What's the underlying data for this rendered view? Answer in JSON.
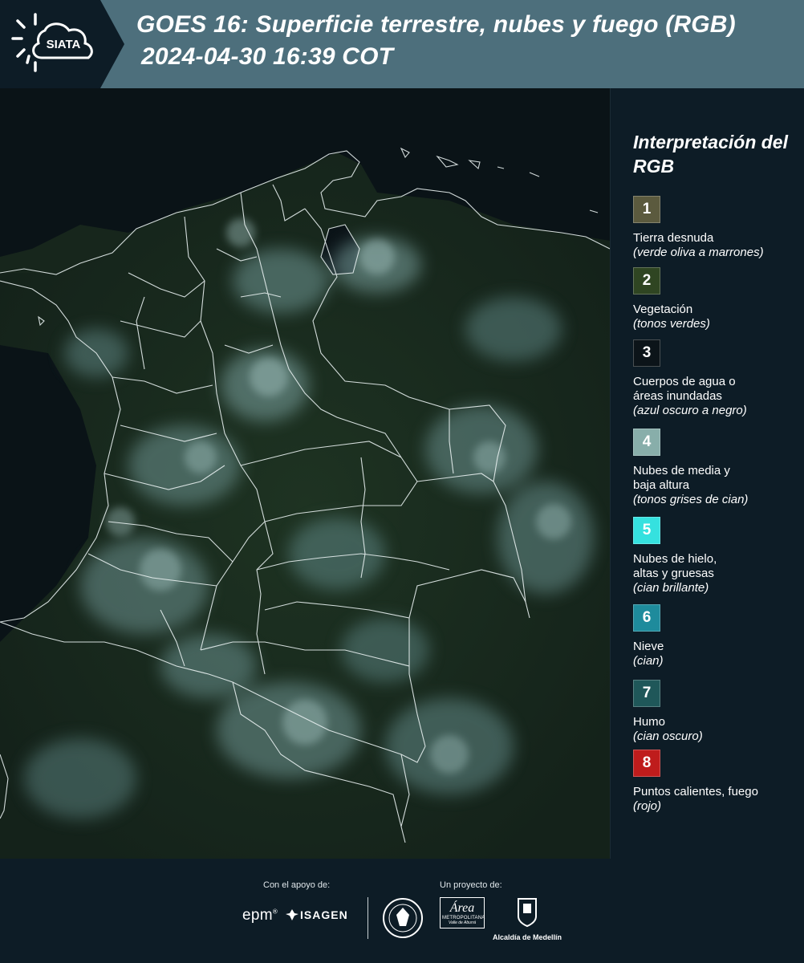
{
  "header": {
    "logo_text": "SIATA",
    "title_line1": "GOES 16: Superficie terrestre, nubes y fuego (RGB)",
    "title_line2": "2024-04-30 16:39 COT"
  },
  "legend": {
    "title": "Interpretación del RGB",
    "items": [
      {
        "number": "1",
        "color": "#5b5a3e",
        "label": "Tierra desnuda",
        "sub": "(verde oliva a marrones)"
      },
      {
        "number": "2",
        "color": "#2f4522",
        "label": "Vegetación",
        "sub": "(tonos verdes)"
      },
      {
        "number": "3",
        "color": "#0c1419",
        "label": "Cuerpos de agua o áreas inundadas",
        "sub": "(azul oscuro a negro)"
      },
      {
        "number": "4",
        "color": "#88aeaa",
        "label": "Nubes de media y baja altura",
        "sub": "(tonos grises de cian)"
      },
      {
        "number": "5",
        "color": "#35e1df",
        "label": "Nubes de hielo, altas y gruesas",
        "sub": "(cian brillante)"
      },
      {
        "number": "6",
        "color": "#1e8b9c",
        "label": "Nieve",
        "sub": "(cian)"
      },
      {
        "number": "7",
        "color": "#1f5759",
        "label": "Humo",
        "sub": "(cian oscuro)"
      },
      {
        "number": "8",
        "color": "#bf1c1c",
        "label": "Puntos calientes, fuego",
        "sub": "(rojo)"
      }
    ]
  },
  "footer": {
    "support_caption": "Con el apoyo de:",
    "project_caption": "Un proyecto de:",
    "epm": "epm",
    "isagen": "ISAGEN",
    "area_metro": "Área",
    "area_metro_sub": "METROPOLITANA",
    "area_metro_sub2": "Valle de Aburrá",
    "alcaldia": "Alcaldía de Medellín"
  }
}
